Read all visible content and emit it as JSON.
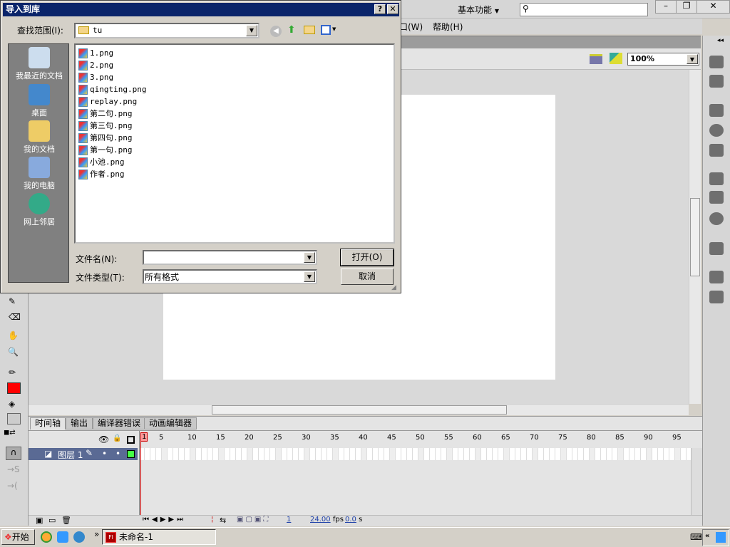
{
  "app": {
    "workspace_label": "基本功能",
    "search_placeholder": "",
    "window_buttons": {
      "minimize": "–",
      "restore": "❐",
      "close": "✕"
    },
    "menu": [
      {
        "label": "口(W)"
      },
      {
        "label": "帮助(H)"
      }
    ],
    "zoom_value": "100%"
  },
  "timeline": {
    "tabs": [
      "时间轴",
      "输出",
      "编译器错误",
      "动画编辑器"
    ],
    "frame_numbers": [
      1,
      5,
      10,
      15,
      20,
      25,
      30,
      35,
      40,
      45,
      50,
      55,
      60,
      65,
      70,
      75,
      80,
      85,
      90,
      95
    ],
    "layer_name": "图层 1",
    "current_frame": "1",
    "fps": "24.00",
    "fps_unit": "fps",
    "elapsed": "0.0",
    "elapsed_unit": "s"
  },
  "taskbar": {
    "start_label": "开始",
    "task_label": "未命名-1",
    "chevron": "»"
  },
  "dialog": {
    "title": "导入到库",
    "help_btn": "?",
    "close_btn": "✕",
    "lookin_label": "查找范围(I):",
    "lookin_value": "tu",
    "places": [
      "我最近的文档",
      "桌面",
      "我的文档",
      "我的电脑",
      "网上邻居"
    ],
    "files": [
      "1.png",
      "2.png",
      "3.png",
      "qingting.png",
      "replay.png",
      "第二句.png",
      "第三句.png",
      "第四句.png",
      "第一句.png",
      "小池.png",
      "作者.png"
    ],
    "filename_label": "文件名(N):",
    "filename_value": "",
    "filetype_label": "文件类型(T):",
    "filetype_value": "所有格式",
    "open_btn": "打开(O)",
    "cancel_btn": "取消"
  },
  "colors": {
    "title_bar": "#0a246a",
    "fill_color": "#ff0000",
    "playhead": "#cc0000",
    "layer_selected": "#5a6a94"
  }
}
